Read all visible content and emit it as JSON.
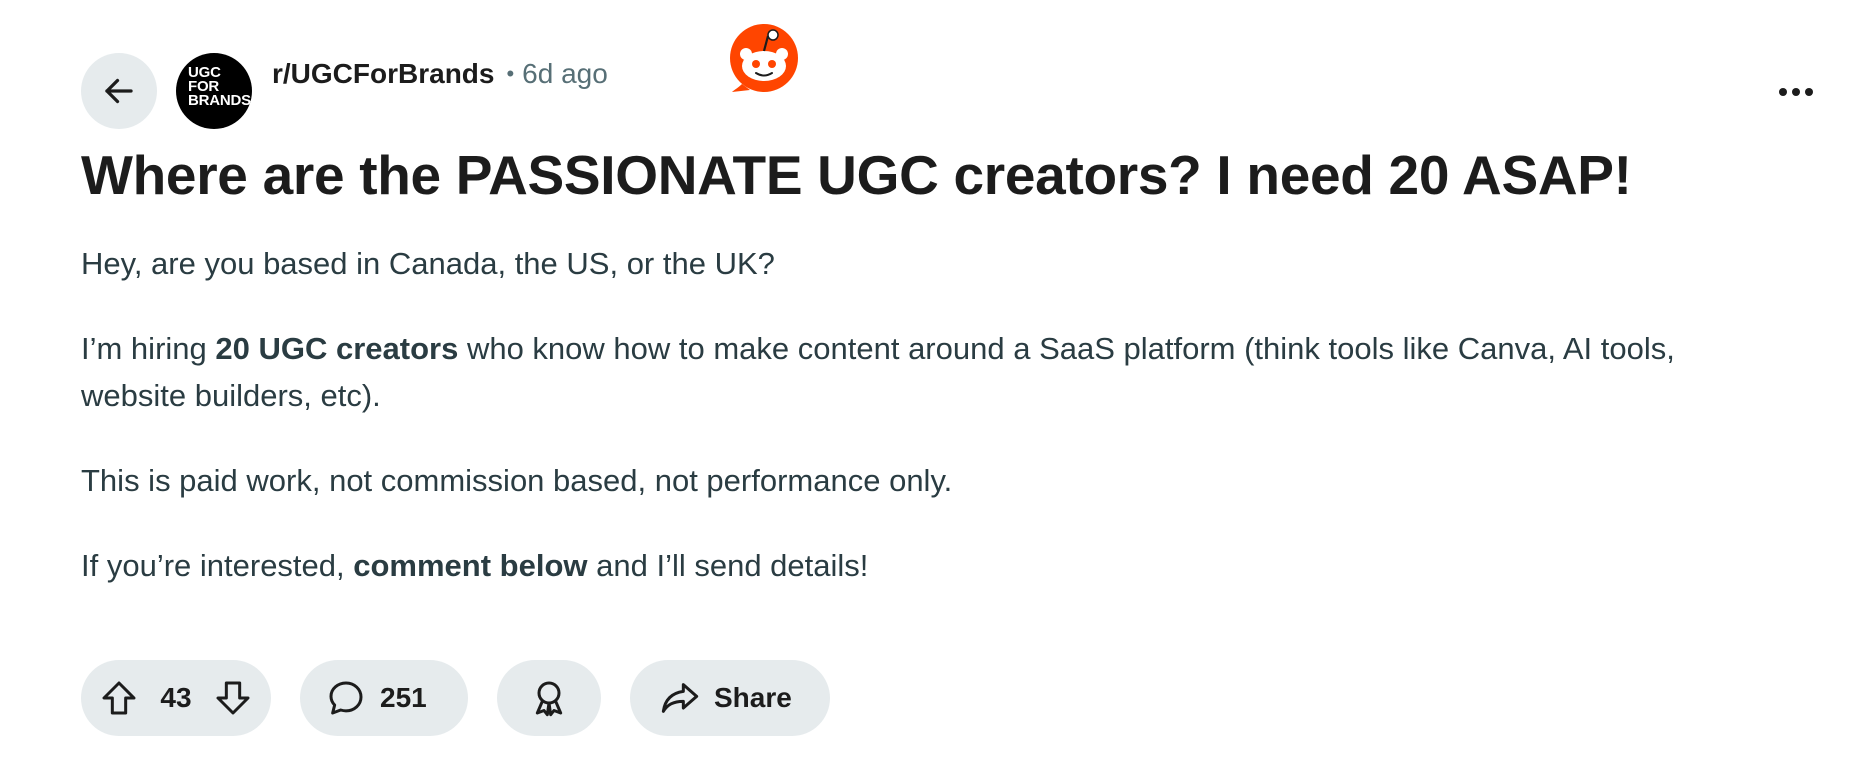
{
  "post": {
    "subreddit": "r/UGCForBrands",
    "separator": "•",
    "age": "6d ago",
    "avatar_text": [
      "UGC",
      "FOR",
      "BRANDS"
    ],
    "title": "Where are the PASSIONATE UGC creators? I need 20 ASAP!",
    "body": {
      "p1": "Hey, are you based in Canada, the US, or the UK?",
      "p2_prefix": "I’m hiring ",
      "p2_bold": "20 UGC creators",
      "p2_suffix": " who know how to make content around a SaaS platform (think tools like Canva, AI tools, website builders, etc).",
      "p3": "This is paid work, not commission based, not performance only.",
      "p4_prefix": "If you’re interested, ",
      "p4_bold": "comment below",
      "p4_suffix": " and I’ll send details!"
    }
  },
  "actions": {
    "votes": "43",
    "comments": "251",
    "share_label": "Share"
  },
  "icons": {
    "back": "arrow-left-icon",
    "more": "more-horizontal-icon",
    "upvote": "arrow-up-icon",
    "downvote": "arrow-down-icon",
    "comment": "speech-bubble-icon",
    "award": "award-ribbon-icon",
    "share": "share-arrow-icon",
    "brand": "reddit-snoo-icon"
  },
  "colors": {
    "brand": "#ff4500",
    "pill_bg": "#e6ebed",
    "body_text": "#2a3c42",
    "meta_text": "#576f76"
  }
}
